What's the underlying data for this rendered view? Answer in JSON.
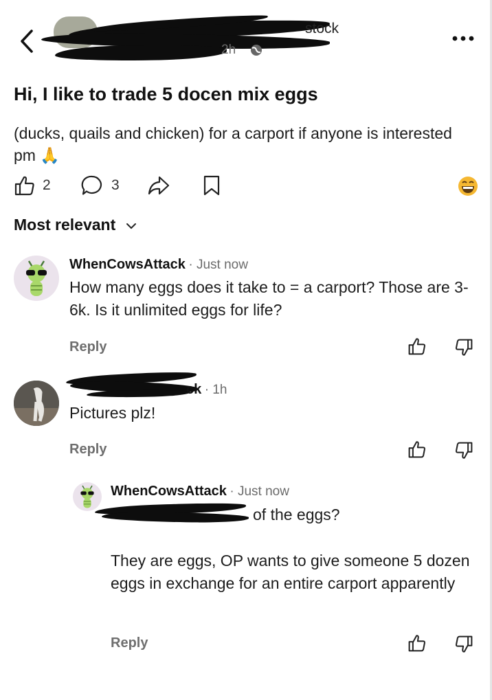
{
  "header": {
    "back_label": "<",
    "group_name_fragment": "stock",
    "time_fragment": "2h",
    "more_label": "•••"
  },
  "post": {
    "title": "Hi, I like to trade 5 docen mix eggs",
    "body": "(ducks, quails and chicken) for a carport if anyone is interested pm",
    "emoji": "🙏",
    "like_count": "2",
    "comment_count": "3"
  },
  "sort": {
    "label": "Most relevant"
  },
  "comments": [
    {
      "author": "WhenCowsAttack",
      "time": "· Just now",
      "text": "How many eggs does it take to = a carport? Those are 3-6k. Is it unlimited eggs for life?",
      "reply_label": "Reply"
    },
    {
      "author_fragment": "ck",
      "time": "· 1h",
      "text": "Pictures plz!",
      "reply_label": "Reply"
    },
    {
      "author": "WhenCowsAttack",
      "time": "· Just now",
      "text_line1": "of the eggs?",
      "text_para": "They are eggs, OP wants to give someone 5 dozen eggs in exchange for an entire carport apparently",
      "reply_label": "Reply"
    }
  ],
  "colors": {
    "text": "#1c1c1c",
    "muted": "#6b6b6b",
    "link": "#2f6fd6",
    "redact": "#0d0d0d"
  }
}
